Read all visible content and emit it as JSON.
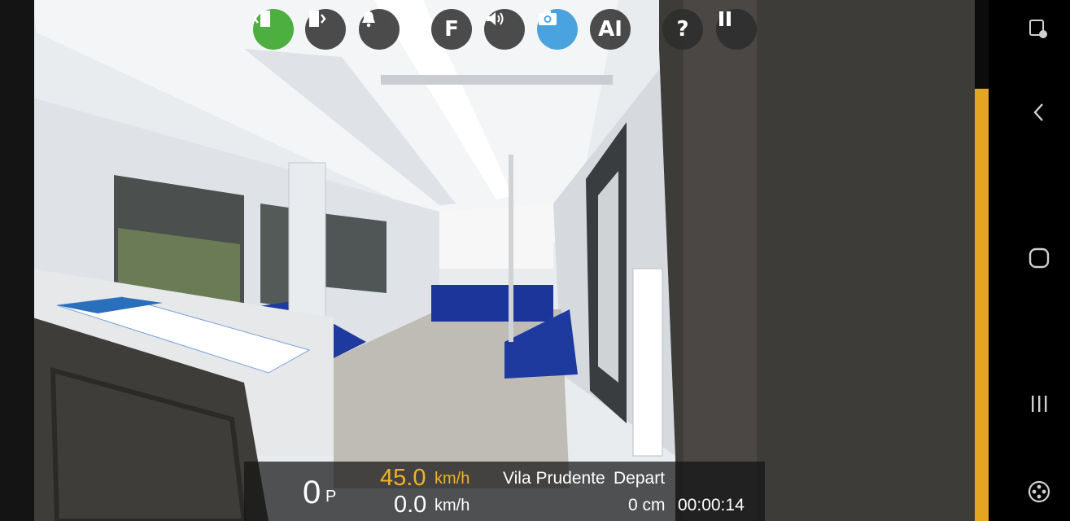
{
  "toolbar": {
    "buttons": [
      {
        "name": "door-left-button",
        "icon": "door-left-icon",
        "active_color": "#4caf3f"
      },
      {
        "name": "door-right-button",
        "icon": "door-right-icon"
      },
      {
        "name": "bell-button",
        "icon": "bell-icon"
      },
      {
        "name": "f-button",
        "label": "F"
      },
      {
        "name": "sound-button",
        "icon": "speaker-icon"
      },
      {
        "name": "camera-button",
        "icon": "camera-icon",
        "active_color": "#4aa3df"
      },
      {
        "name": "ai-button",
        "label": "AI"
      },
      {
        "name": "help-button",
        "label": "?"
      },
      {
        "name": "pause-button",
        "icon": "pause-icon"
      }
    ]
  },
  "hud": {
    "power_value": "0",
    "power_unit": "P",
    "target_speed": "45.0",
    "target_speed_unit": "km/h",
    "target_speed_color": "#f0b22b",
    "current_speed": "0.0",
    "current_speed_unit": "km/h",
    "station": "Vila Prudente",
    "station_status": "Depart",
    "distance": "0 cm",
    "timer": "00:00:14"
  },
  "progress": {
    "fraction": 0.83,
    "color": "#e4a521"
  },
  "navbar": {
    "icons": [
      "screen-touch-icon",
      "back-icon",
      "home-icon",
      "recents-icon",
      "gamepad-icon"
    ]
  }
}
